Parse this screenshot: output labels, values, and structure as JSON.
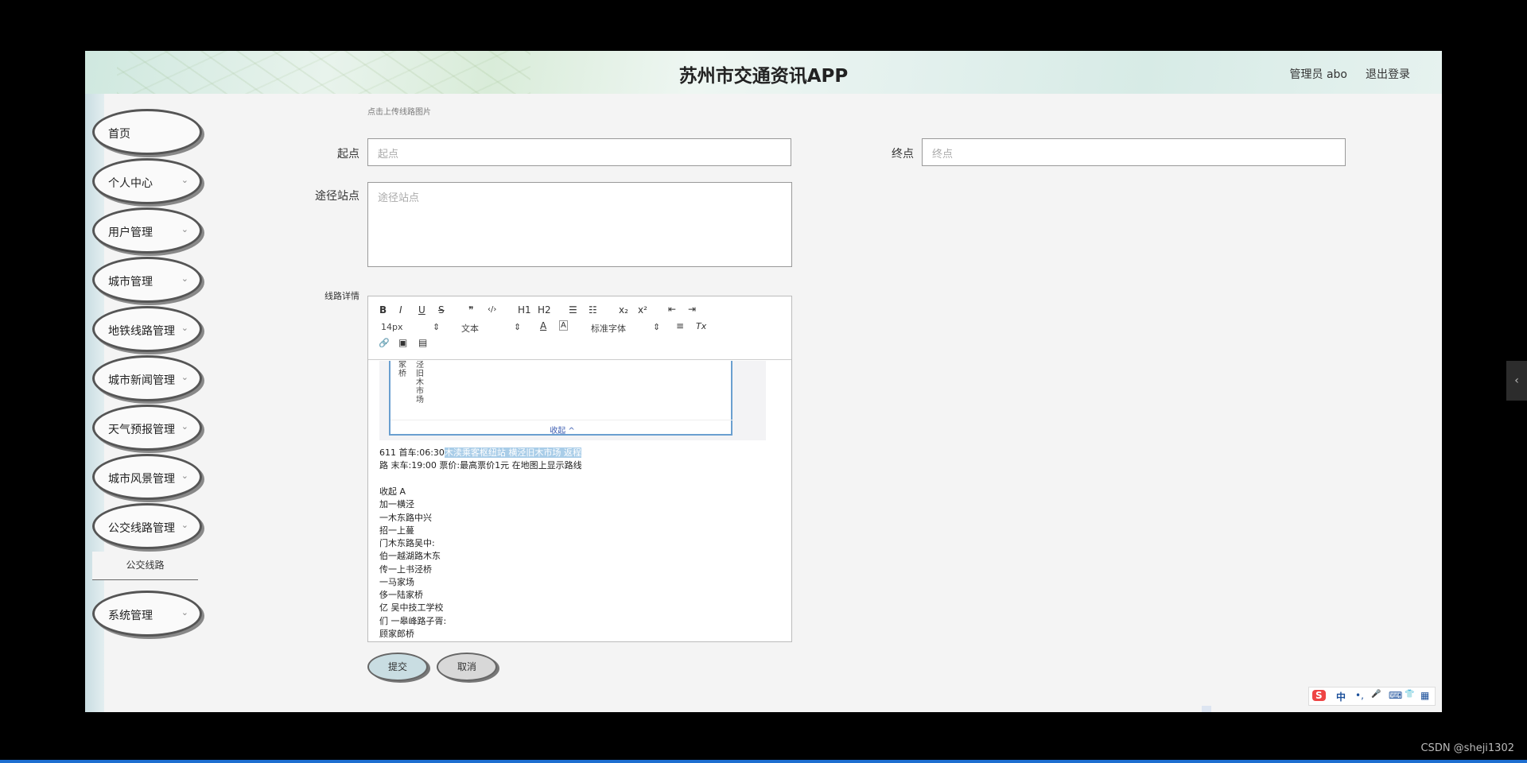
{
  "header": {
    "app_title": "苏州市交通资讯APP",
    "admin_label": "管理员 abo",
    "logout_label": "退出登录"
  },
  "sidebar": {
    "items": [
      {
        "label": "首页",
        "has_chevron": false
      },
      {
        "label": "个人中心",
        "has_chevron": true
      },
      {
        "label": "用户管理",
        "has_chevron": true
      },
      {
        "label": "城市管理",
        "has_chevron": true
      },
      {
        "label": "地铁线路管理",
        "has_chevron": true
      },
      {
        "label": "城市新闻管理",
        "has_chevron": true
      },
      {
        "label": "天气预报管理",
        "has_chevron": true
      },
      {
        "label": "城市风景管理",
        "has_chevron": true
      },
      {
        "label": "公交线路管理",
        "has_chevron": true
      },
      {
        "label": "系统管理",
        "has_chevron": true
      }
    ],
    "sub_item": "公交线路",
    "chevron_icon": "chevron-down-icon"
  },
  "form": {
    "upload_hint": "点击上传线路图片",
    "start_label": "起点",
    "start_placeholder": "起点",
    "end_label": "终点",
    "end_placeholder": "终点",
    "via_label": "途径站点",
    "via_placeholder": "途径站点",
    "detail_label": "线路详情"
  },
  "editor": {
    "toolbar": {
      "bold": "B",
      "italic": "I",
      "underline": "U",
      "strike": "S",
      "quote": "❞",
      "code": "‹/›",
      "h1": "H1",
      "h2": "H2",
      "ordered_list": "☰",
      "bullet_list": "☷",
      "sub": "x₂",
      "sup": "x²",
      "outdent": "⇤",
      "indent": "⇥",
      "font_size": "14px",
      "text_type": "文本",
      "font_family": "标准字体",
      "align": "≡",
      "clear_format": "Tx",
      "link": "🔗",
      "image": "▣",
      "video": "▤"
    },
    "image_card": {
      "vcol1": "家桥",
      "vcol2": "泾旧木市场",
      "collapse": "收起 ^"
    },
    "line1_prefix": "611 首车:06:30",
    "line1_highlight": "木渎乘客枢纽站 横泾旧木市场 返程",
    "line2": "路 末车:19:00 票价:最高票价1元 在地图上显示路线",
    "list_lines": [
      "收起 A",
      "加一横泾",
      "一木东路中兴",
      "招一上蔓",
      "门木东路吴中:",
      "伯一越湖路木东",
      "传一上书泾桥",
      "一马家场",
      "侈一陆家桥",
      "亿 吴中技工学校",
      "们 一皋峰路子胥:",
      "顾家郎桥"
    ]
  },
  "buttons": {
    "submit": "提交",
    "cancel": "取消"
  },
  "overlay": {
    "ime_labels": [
      "S",
      "中",
      "•,",
      "🎤",
      "⌨",
      "👕",
      "▦"
    ],
    "watermark": "CSDN @sheji1302",
    "right_tab_icon": "‹"
  }
}
